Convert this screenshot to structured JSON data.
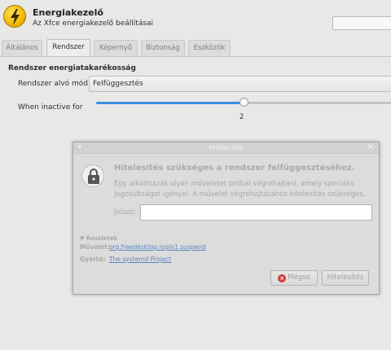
{
  "header": {
    "title": "Energiakezelő",
    "subtitle": "Az Xfce energiakezelő beállításai",
    "icon": "lightning-icon"
  },
  "tabs": [
    {
      "label": "Általános",
      "active": false
    },
    {
      "label": "Rendszer",
      "active": true
    },
    {
      "label": "Képernyő",
      "active": false
    },
    {
      "label": "Biztonság",
      "active": false
    },
    {
      "label": "Eszközök",
      "active": false
    }
  ],
  "system": {
    "section_title": "Rendszer energiatakarékosság",
    "sleep_mode_label": "Rendszer alvó mód:",
    "sleep_mode_value": "Felfüggesztés",
    "inactive_label": "When inactive for",
    "inactive_value": "2",
    "inactive_fraction": 0.49,
    "accent_color": "#3d8fe0"
  },
  "auth_dialog": {
    "window_title": "Hitelesítés",
    "heading": "Hitelesítés szükséges a rendszer felfüggesztéséhez.",
    "message": "Egy alkalmazás olyan műveletet próbál végrehajtani, amely speciális jogosultságot igényel. A művelet végrehajtásához hitelesítés szükséges.",
    "password_label": "Jelszó:",
    "password_value": "",
    "details_label": "Részletek",
    "action_label": "Művelet:",
    "action_value": "org.freedesktop.login1.suspend",
    "vendor_label": "Gyártó:",
    "vendor_value": "The systemd Project",
    "cancel_label": "Mégse",
    "auth_label": "Hitelesítés",
    "icon": "lock-icon"
  }
}
